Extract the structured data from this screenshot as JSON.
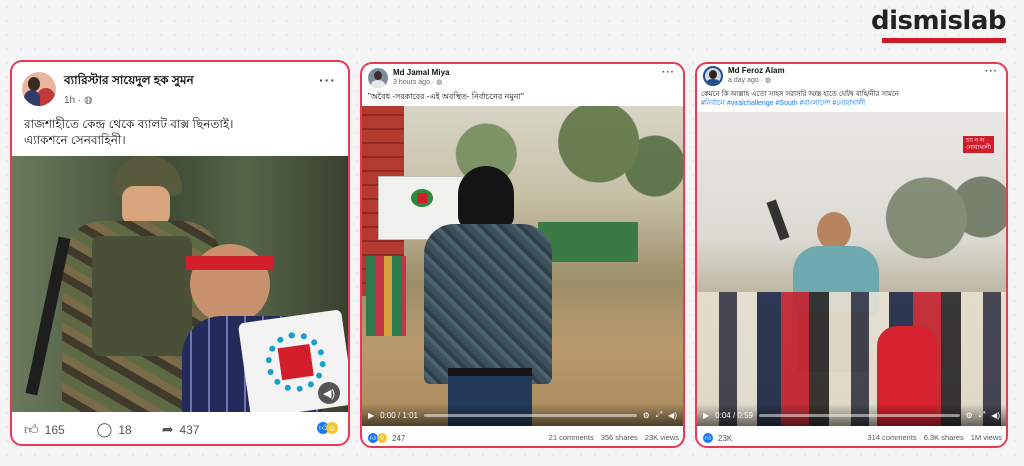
{
  "brand": {
    "name": "dismislab",
    "accent": "#d5192c"
  },
  "posts": [
    {
      "author": "ব্যারিস্টার সায়েদুল হক সুমন",
      "time": "1h · ",
      "text_line1": "রাজশাহীতে কেন্দ্র থেকে ব্যালট বাক্স ছিনতাই।",
      "text_line2": "এ্যাকশনে সেনবাহিনী।",
      "likes": "165",
      "comments": "18",
      "shares": "437"
    },
    {
      "author": "Md Jamal Miya",
      "time": "3 hours ago · ",
      "text": "\"অবৈধ -সরকারের -এই অবস্থিত- নির্বাচনের নমুনা\"",
      "video_time": "0:00 / 1:01",
      "reactions": "247",
      "comments": "21 comments",
      "shares": "356 shares",
      "views": "23K views"
    },
    {
      "author": "Md Feroz Alam",
      "time": "a day ago · ",
      "text": "কেমনে কি আল্লাহ এতো সাহস সরাসরি অ/স্ত্র হাতে ঘোঁ/ষ বাহি/নীর সামনে",
      "hashtags": "#নির্বাচন #viralchallenge #South #বাংলাদেশ #নোয়াখালী",
      "video_time": "0:04 / 0:59",
      "watermark": "নোয়াখালী",
      "reactions": "23K",
      "comments": "314 comments",
      "shares": "6.3K shares",
      "views": "1M views"
    }
  ]
}
